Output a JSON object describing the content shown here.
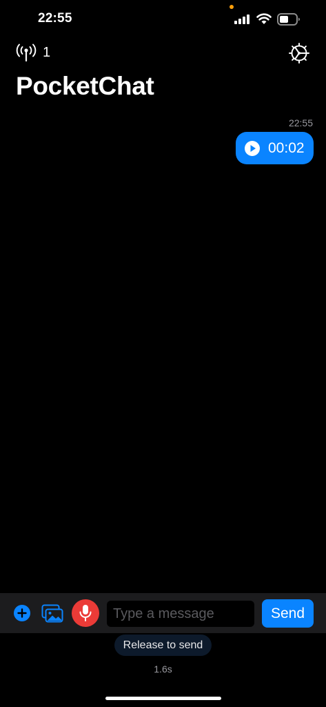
{
  "status_bar": {
    "time": "22:55"
  },
  "header": {
    "peer_count": "1",
    "title": "PocketChat"
  },
  "messages": [
    {
      "time": "22:55",
      "type": "voice",
      "duration": "00:02"
    }
  ],
  "composer": {
    "placeholder": "Type a message",
    "send_label": "Send"
  },
  "recording": {
    "hint": "Release to send",
    "elapsed": "1.6s"
  },
  "colors": {
    "accent": "#0a84ff",
    "record": "#eb3b37",
    "background": "#000000",
    "composer_bg": "#1c1c1e"
  },
  "icons": {
    "peers": "antenna-broadcast-icon",
    "settings": "gear-icon",
    "play": "play-icon",
    "add": "plus-circle-icon",
    "photos": "photo-library-icon",
    "mic": "microphone-icon"
  }
}
